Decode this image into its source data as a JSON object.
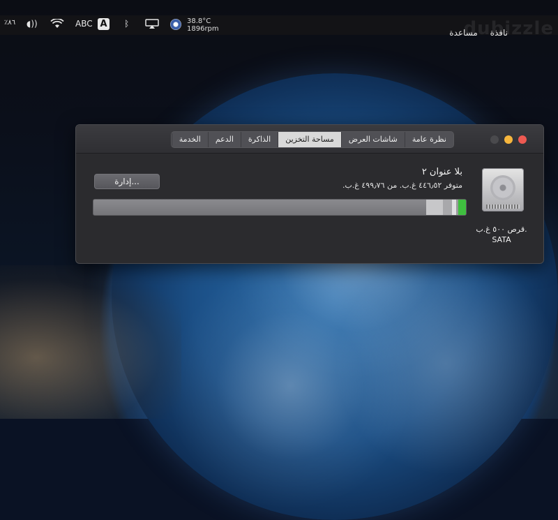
{
  "menubar": {
    "left_text": "٪٨٦",
    "input_source": "ABC",
    "input_badge": "A",
    "temperature": "38.8°C",
    "fan_speed": "1896rpm",
    "menus": [
      "نافذة",
      "مساعدة"
    ],
    "watermark": "dubizzle"
  },
  "window": {
    "tabs": [
      {
        "label": "نظرة عامة",
        "selected": false
      },
      {
        "label": "شاشات العرض",
        "selected": false
      },
      {
        "label": "مساحة التخزين",
        "selected": true
      },
      {
        "label": "الذاكرة",
        "selected": false
      },
      {
        "label": "الدعم",
        "selected": false
      },
      {
        "label": "الخدمة",
        "selected": false
      }
    ],
    "volume_name": "بلا عنوان ٢",
    "available_text": "متوفر ٤٤٦٫٥٢ غ.ب. من ٤٩٩٫٧٦ غ.ب.",
    "manage_button": "إدارة...",
    "disk_label_line1": "قرص ٥٠٠ غ.ب.",
    "disk_label_line2": "SATA",
    "storage": {
      "free_fraction": 0.893,
      "segments": [
        {
          "fraction": 0.045,
          "color": "#c7c7c9"
        },
        {
          "fraction": 0.024,
          "color": "#a8a8ab"
        },
        {
          "fraction": 0.012,
          "color": "#e0e0e2"
        },
        {
          "fraction": 0.005,
          "color": "#9a9a9d"
        },
        {
          "fraction": 0.021,
          "color": "#3fbf3f"
        }
      ]
    }
  }
}
